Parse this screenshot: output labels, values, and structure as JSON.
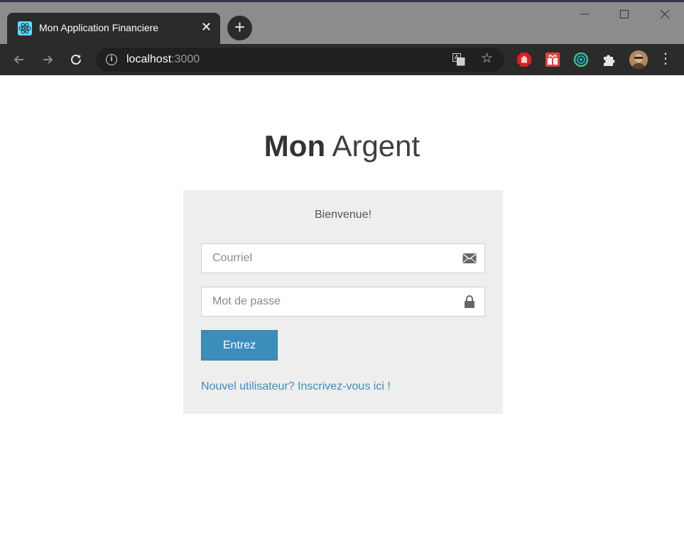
{
  "browser": {
    "tab_title": "Mon Application Financiere",
    "tab_close": "✕",
    "new_tab": "+",
    "url_host": "localhost",
    "url_port": ":3000",
    "icons": {
      "favicon": "react-icon",
      "translate": "translate-icon",
      "bookmark": "star-icon",
      "extensions": [
        "stop-hand-icon",
        "gift-icon",
        "ring-icon",
        "puzzle-icon"
      ],
      "profile": "avatar",
      "menu": "kebab-menu-icon"
    },
    "colors": {
      "chrome_dark": "#2b2b2b",
      "titlebar": "#8c8c8c",
      "omnibox": "#202020"
    }
  },
  "page": {
    "brand_bold": "Mon",
    "brand_light": "Argent",
    "welcome": "Bienvenue!",
    "email_placeholder": "Courriel",
    "password_placeholder": "Mot de passe",
    "submit_label": "Entrez",
    "register_link": "Nouvel utilisateur? Inscrivez-vous ici !",
    "colors": {
      "accent": "#3c8dbc",
      "card_bg": "#eeeeee",
      "text": "#333333"
    }
  }
}
